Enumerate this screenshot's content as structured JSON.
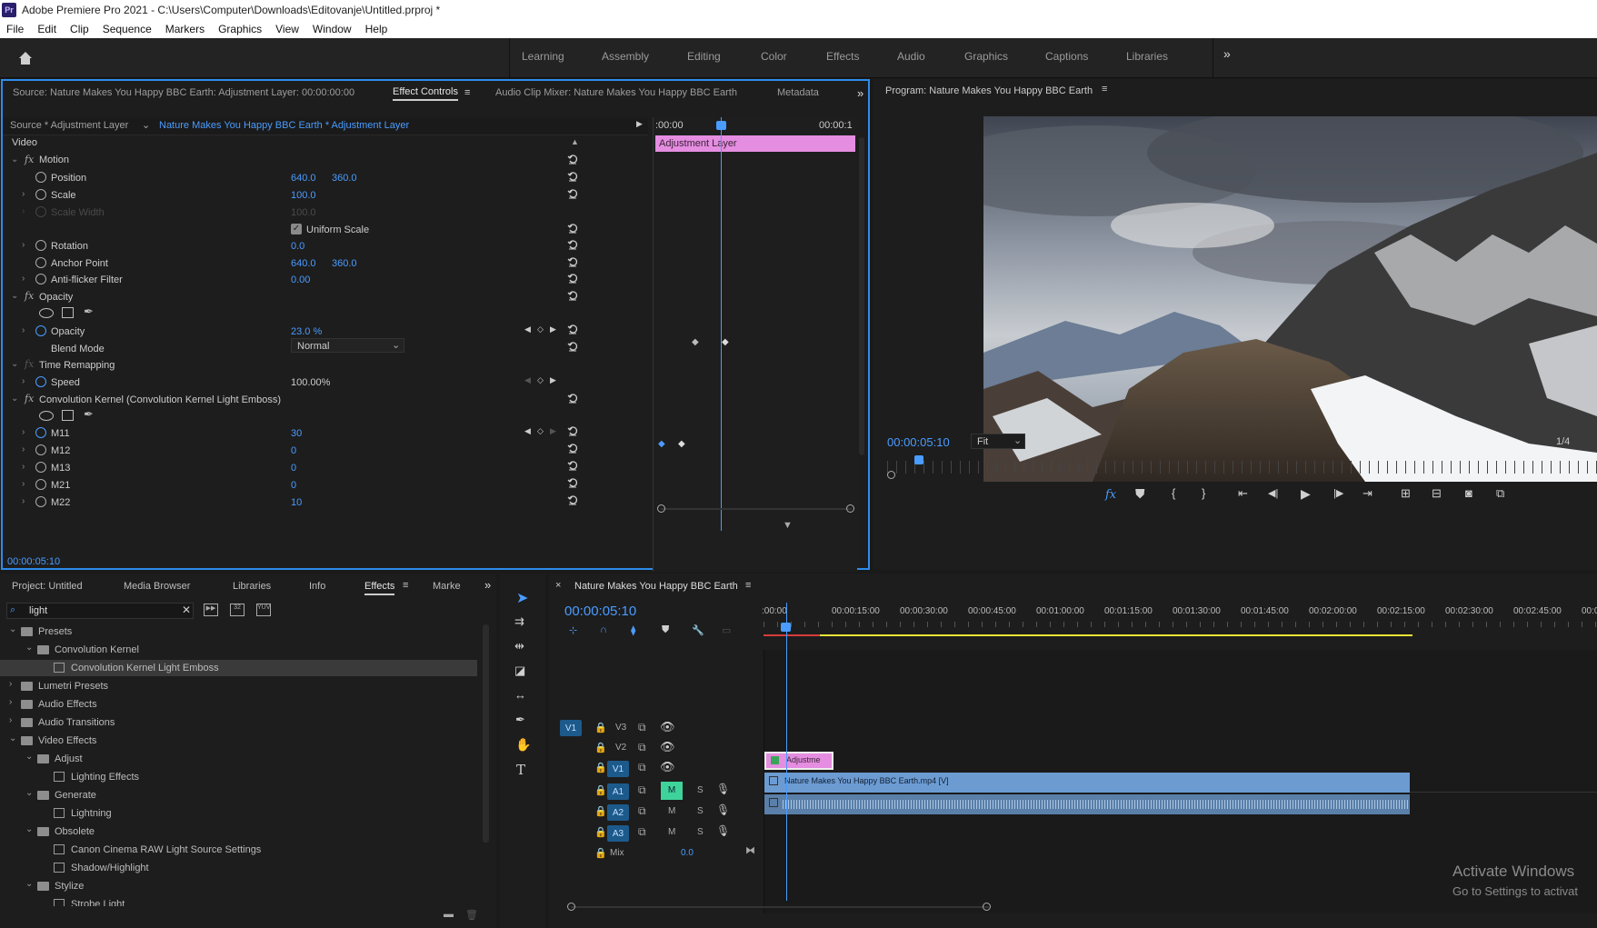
{
  "app": {
    "title": "Adobe Premiere Pro 2021 - C:\\Users\\Computer\\Downloads\\Editovanje\\Untitled.prproj *",
    "logo": "Pr"
  },
  "menu": [
    "File",
    "Edit",
    "Clip",
    "Sequence",
    "Markers",
    "Graphics",
    "View",
    "Window",
    "Help"
  ],
  "workspaces": [
    "Learning",
    "Assembly",
    "Editing",
    "Color",
    "Effects",
    "Audio",
    "Graphics",
    "Captions",
    "Libraries"
  ],
  "effect_controls": {
    "tabs": {
      "source": "Source: Nature Makes You Happy BBC Earth: Adjustment Layer: 00:00:00:00",
      "effect_controls": "Effect Controls",
      "audio_mixer": "Audio Clip Mixer: Nature Makes You Happy BBC Earth",
      "metadata": "Metadata"
    },
    "source_label": "Source * Adjustment Layer",
    "sequence_label": "Nature Makes You Happy BBC Earth * Adjustment Layer",
    "time_start": ":00:00",
    "time_end": "00:00:1",
    "clip_name": "Adjustment Layer",
    "section_video": "Video",
    "motion": "Motion",
    "position": {
      "label": "Position",
      "x": "640.0",
      "y": "360.0"
    },
    "scale": {
      "label": "Scale",
      "value": "100.0"
    },
    "scale_width": {
      "label": "Scale Width",
      "value": "100.0"
    },
    "uniform_scale": "Uniform Scale",
    "rotation": {
      "label": "Rotation",
      "value": "0.0"
    },
    "anchor": {
      "label": "Anchor Point",
      "x": "640.0",
      "y": "360.0"
    },
    "antiflicker": {
      "label": "Anti-flicker Filter",
      "value": "0.00"
    },
    "opacity_group": "Opacity",
    "opacity": {
      "label": "Opacity",
      "value": "23.0 %"
    },
    "blend_mode": {
      "label": "Blend Mode",
      "value": "Normal"
    },
    "time_remap": "Time Remapping",
    "speed": {
      "label": "Speed",
      "value": "100.00%"
    },
    "conv_kernel": "Convolution Kernel (Convolution Kernel Light Emboss)",
    "m11": {
      "label": "M11",
      "value": "30"
    },
    "m12": {
      "label": "M12",
      "value": "0"
    },
    "m13": {
      "label": "M13",
      "value": "0"
    },
    "m21": {
      "label": "M21",
      "value": "0"
    },
    "m22": {
      "label": "M22",
      "value": "10"
    },
    "timecode": "00:00:05:10"
  },
  "program": {
    "title": "Program: Nature Makes You Happy BBC Earth",
    "timecode": "00:00:05:10",
    "fit": "Fit",
    "resolution": "1/4"
  },
  "project": {
    "tabs": [
      "Project: Untitled",
      "Media Browser",
      "Libraries",
      "Info",
      "Effects",
      "Marke"
    ],
    "search": "light",
    "tree": [
      {
        "label": "Presets",
        "depth": 0,
        "type": "folder",
        "open": true
      },
      {
        "label": "Convolution Kernel",
        "depth": 1,
        "type": "folder",
        "open": true
      },
      {
        "label": "Convolution Kernel Light Emboss",
        "depth": 2,
        "type": "preset",
        "selected": true
      },
      {
        "label": "Lumetri Presets",
        "depth": 0,
        "type": "folder",
        "open": false
      },
      {
        "label": "Audio Effects",
        "depth": 0,
        "type": "folder",
        "open": false
      },
      {
        "label": "Audio Transitions",
        "depth": 0,
        "type": "folder",
        "open": false
      },
      {
        "label": "Video Effects",
        "depth": 0,
        "type": "folder",
        "open": true
      },
      {
        "label": "Adjust",
        "depth": 1,
        "type": "folder",
        "open": true
      },
      {
        "label": "Lighting Effects",
        "depth": 2,
        "type": "effect"
      },
      {
        "label": "Generate",
        "depth": 1,
        "type": "folder",
        "open": true
      },
      {
        "label": "Lightning",
        "depth": 2,
        "type": "effect"
      },
      {
        "label": "Obsolete",
        "depth": 1,
        "type": "folder",
        "open": true
      },
      {
        "label": "Canon Cinema RAW Light Source Settings",
        "depth": 2,
        "type": "effect"
      },
      {
        "label": "Shadow/Highlight",
        "depth": 2,
        "type": "effect"
      },
      {
        "label": "Stylize",
        "depth": 1,
        "type": "folder",
        "open": true
      },
      {
        "label": "Strobe Light",
        "depth": 2,
        "type": "effect"
      }
    ]
  },
  "timeline": {
    "title": "Nature Makes You Happy BBC Earth",
    "timecode": "00:00:05:10",
    "ruler": [
      ":00:00",
      "00:00:15:00",
      "00:00:30:00",
      "00:00:45:00",
      "00:01:00:00",
      "00:01:15:00",
      "00:01:30:00",
      "00:01:45:00",
      "00:02:00:00",
      "00:02:15:00",
      "00:02:30:00",
      "00:02:45:00",
      "00:03:00"
    ],
    "tracks": {
      "v1_src": "V1",
      "v3": "V3",
      "v2": "V2",
      "v1": "V1",
      "a1": "A1",
      "a2": "A2",
      "a3": "A3",
      "m": "M",
      "s": "S",
      "mix": "Mix",
      "mix_value": "0.0"
    },
    "clips": {
      "adjust": "Adjustme",
      "video": "Nature Makes You Happy BBC Earth.mp4 [V]"
    }
  },
  "watermark": {
    "line1": "Activate Windows",
    "line2": "Go to Settings to activat"
  },
  "colors": {
    "accent": "#4a9cff",
    "adjustment_clip": "#e58de0",
    "video_clip": "#6c9bd2",
    "audio_clip": "#5a7fa8",
    "render_bar": "#e8e337"
  }
}
